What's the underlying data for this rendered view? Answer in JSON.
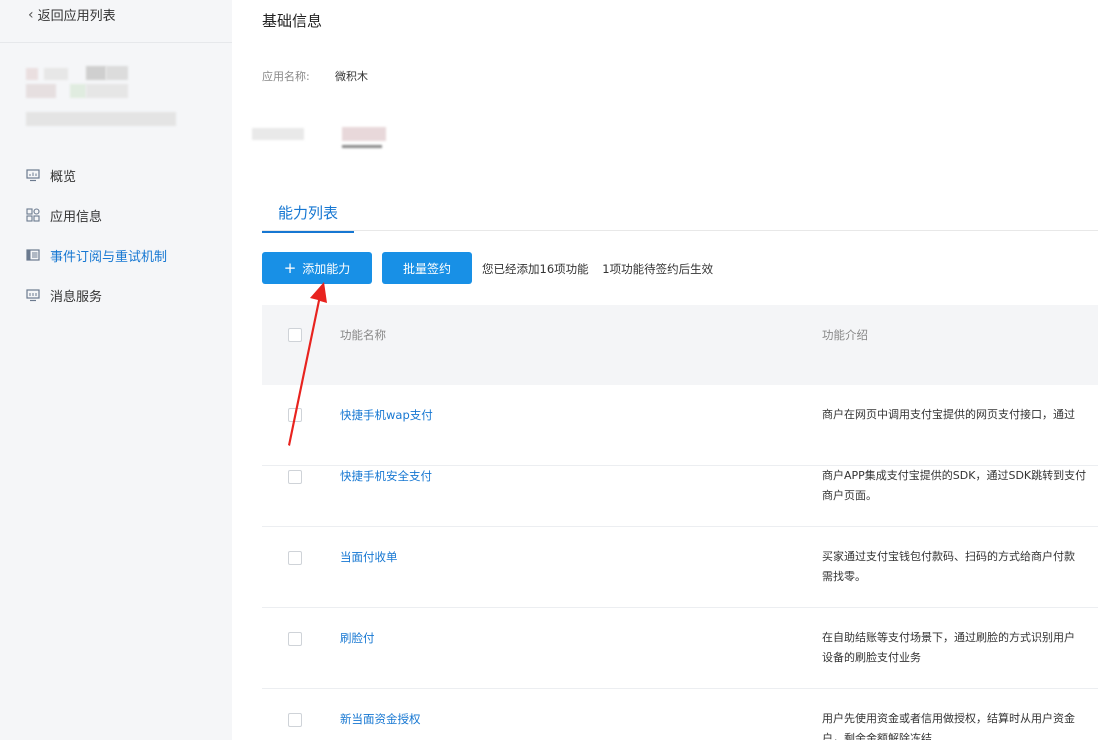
{
  "sidebar": {
    "back_label": "返回应用列表",
    "items": [
      {
        "label": "概览",
        "icon": "monitor-chart-icon",
        "active": false
      },
      {
        "label": "应用信息",
        "icon": "grid-apps-icon",
        "active": false
      },
      {
        "label": "事件订阅与重试机制",
        "icon": "list-card-icon",
        "active": true
      },
      {
        "label": "消息服务",
        "icon": "message-monitor-icon",
        "active": false
      }
    ]
  },
  "basic_info": {
    "title": "基础信息",
    "app_name_label": "应用名称:",
    "app_name_value": "微积木"
  },
  "tabs": [
    {
      "label": "能力列表",
      "active": true
    }
  ],
  "toolbar": {
    "add_label": "添加能力",
    "batch_label": "批量签约",
    "summary_added": "您已经添加16项功能",
    "summary_pending": "1项功能待签约后生效"
  },
  "table": {
    "headers": [
      "功能名称",
      "功能介绍"
    ],
    "rows": [
      {
        "name": "快捷手机wap支付",
        "desc": [
          "商户在网页中调用支付宝提供的网页支付接口，通过"
        ]
      },
      {
        "name": "快捷手机安全支付",
        "desc": [
          "商户APP集成支付宝提供的SDK，通过SDK跳转到支付",
          "商户页面。"
        ]
      },
      {
        "name": "当面付收单",
        "desc": [
          "买家通过支付宝钱包付款码、扫码的方式给商户付款",
          "需找零。"
        ]
      },
      {
        "name": "刷脸付",
        "desc": [
          "在自助结账等支付场景下，通过刷脸的方式识别用户",
          "设备的刷脸支付业务"
        ]
      },
      {
        "name": "新当面资金授权",
        "desc": [
          "用户先使用资金或者信用做授权，结算时从用户资金",
          "户，剩余金额解除冻结"
        ]
      }
    ]
  },
  "colors": {
    "accent": "#1677d2",
    "button": "#1890e6",
    "annotation_arrow": "#e8231f"
  }
}
